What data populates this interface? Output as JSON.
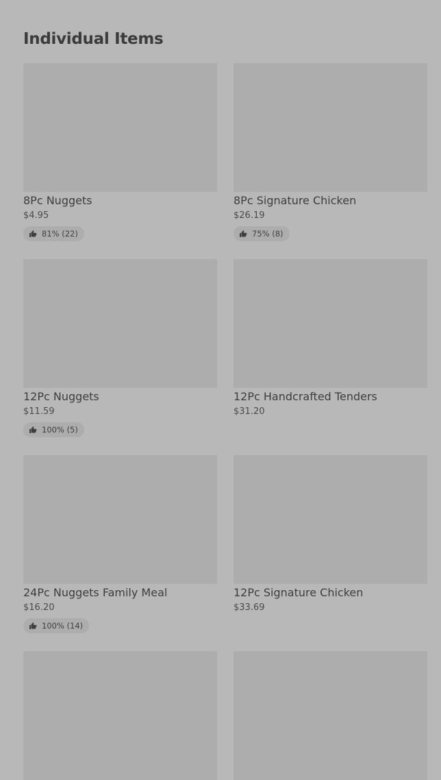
{
  "section": {
    "title": "Individual Items"
  },
  "items": [
    {
      "name": "8Pc Nuggets",
      "price": "$4.95",
      "rating": "81% (22)"
    },
    {
      "name": "8Pc Signature Chicken",
      "price": "$26.19",
      "rating": "75% (8)"
    },
    {
      "name": "12Pc Nuggets",
      "price": "$11.59",
      "rating": "100% (5)"
    },
    {
      "name": "12Pc Handcrafted Tenders",
      "price": "$31.20",
      "rating": null
    },
    {
      "name": "24Pc Nuggets Family Meal",
      "price": "$16.20",
      "rating": "100% (14)"
    },
    {
      "name": "12Pc Signature Chicken",
      "price": "$33.69",
      "rating": null
    },
    {
      "name": "",
      "price": "",
      "rating": null
    },
    {
      "name": "",
      "price": "",
      "rating": null
    }
  ],
  "icons": {
    "rating": "thumbs-up-icon"
  },
  "colors": {
    "background": "#b8b8b8",
    "image_placeholder": "#adadad",
    "text": "#3d3d3d"
  }
}
